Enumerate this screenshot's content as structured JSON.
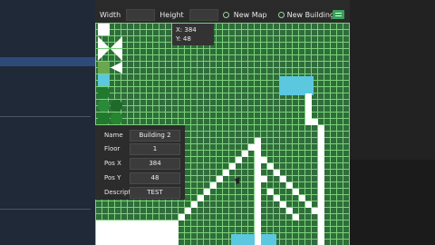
{
  "toolbar": {
    "width_label": "Width",
    "height_label": "Height",
    "new_map_label": "New Map",
    "new_building_label": "New Building"
  },
  "coords": {
    "x": "X: 384",
    "y": "Y: 48"
  },
  "properties": {
    "name_label": "Name",
    "name_value": "Building 2",
    "floor_label": "Floor",
    "floor_value": "1",
    "posx_label": "Pos X",
    "posx_value": "384",
    "posy_label": "Pos Y",
    "posy_value": "48",
    "desc_label": "Descript",
    "desc_value": "TEST"
  },
  "colors": {
    "grass": "#2f6d3a",
    "grid_line": "#7bd07b",
    "wall": "#ffffff",
    "water": "#5bc8e0",
    "accent": "#3aa05a"
  },
  "icons": [
    "menu-icon",
    "radio-icon",
    "cursor-icon"
  ]
}
